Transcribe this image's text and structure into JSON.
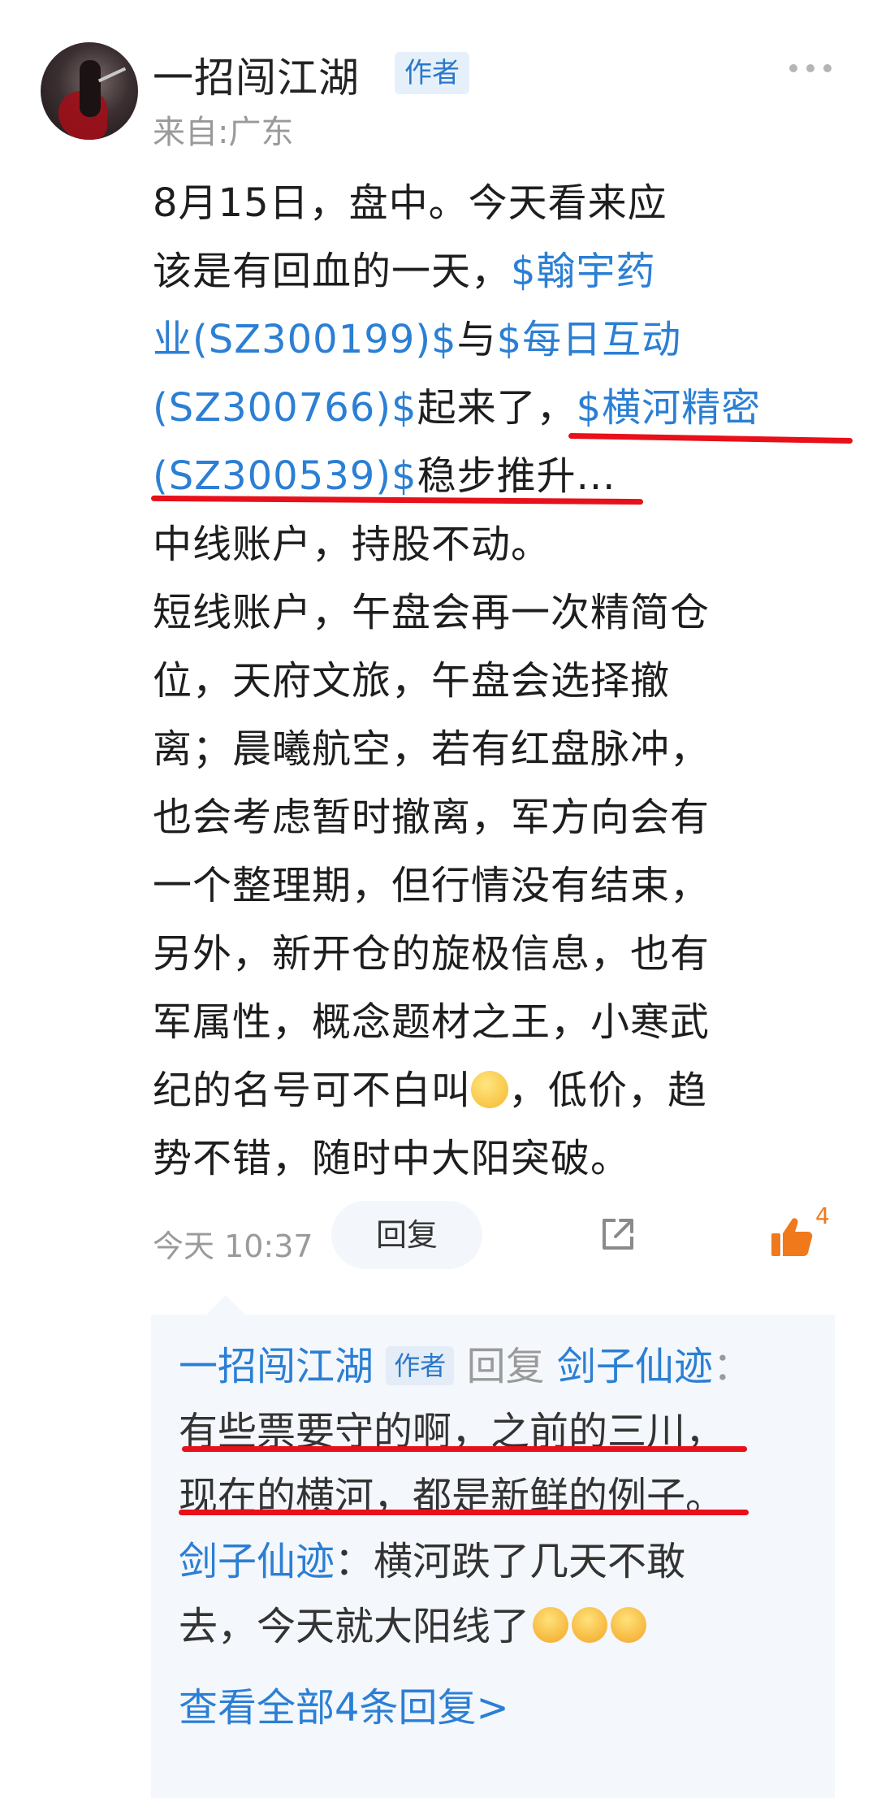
{
  "post": {
    "author": "一招闯江湖",
    "author_badge": "作者",
    "location": "来自:广东",
    "line1": "8月15日，盘中。今天看来应",
    "line2_prefix": "该是有回血的一天，",
    "stock1_part1": "$翰宇药",
    "stock1_part2": "业(SZ300199)$",
    "conj": "与",
    "stock2_part1": "$每日互动",
    "stock2_part2": "(SZ300766)$",
    "rise_text": "起来了，",
    "stock3_part1": "$横河精密",
    "stock3_part2": "(SZ300539)$",
    "steady_text": "稳步推升...",
    "para2": "中线账户，持股不动。",
    "para3_l1": "短线账户，午盘会再一次精简仓",
    "para3_l2": "位，天府文旅，午盘会选择撤",
    "para3_l3": "离；晨曦航空，若有红盘脉冲，",
    "para3_l4": "也会考虑暂时撤离，军方向会有",
    "para3_l5": "一个整理期，但行情没有结束，",
    "para3_l6": "另外，新开仓的旋极信息，也有",
    "para3_l7": "军属性，概念题材之王，小寒武",
    "para3_l8a": "纪的名号可不白叫",
    "para3_l8b": "，低价，趋",
    "para3_l9": "势不错，随时中大阳突破。",
    "time": "今天 10:37",
    "reply_label": "回复",
    "like_count": "4"
  },
  "replies": {
    "r1_name": "一招闯江湖",
    "r1_badge": "作者",
    "r1_reply_word": "回复",
    "r1_target": "剑子仙迹",
    "r1_colon": "：",
    "r1_line1": "有些票要守的啊，之前的三川，",
    "r1_line2": "现在的横河，都是新鲜的例子。",
    "r2_name": "剑子仙迹",
    "r2_text1": "：横河跌了几天不敢",
    "r2_text2": "去，今天就大阳线了",
    "view_all": "查看全部4条回复>"
  },
  "icons": {
    "more": "more-dots-icon",
    "share": "share-icon",
    "like": "thumbs-up-icon",
    "emoji": "smirk-emoji-icon",
    "cry": "crying-emoji-icon"
  },
  "colors": {
    "link": "#2b7fd4",
    "underline": "#e8101a",
    "like": "#f07a1b"
  }
}
